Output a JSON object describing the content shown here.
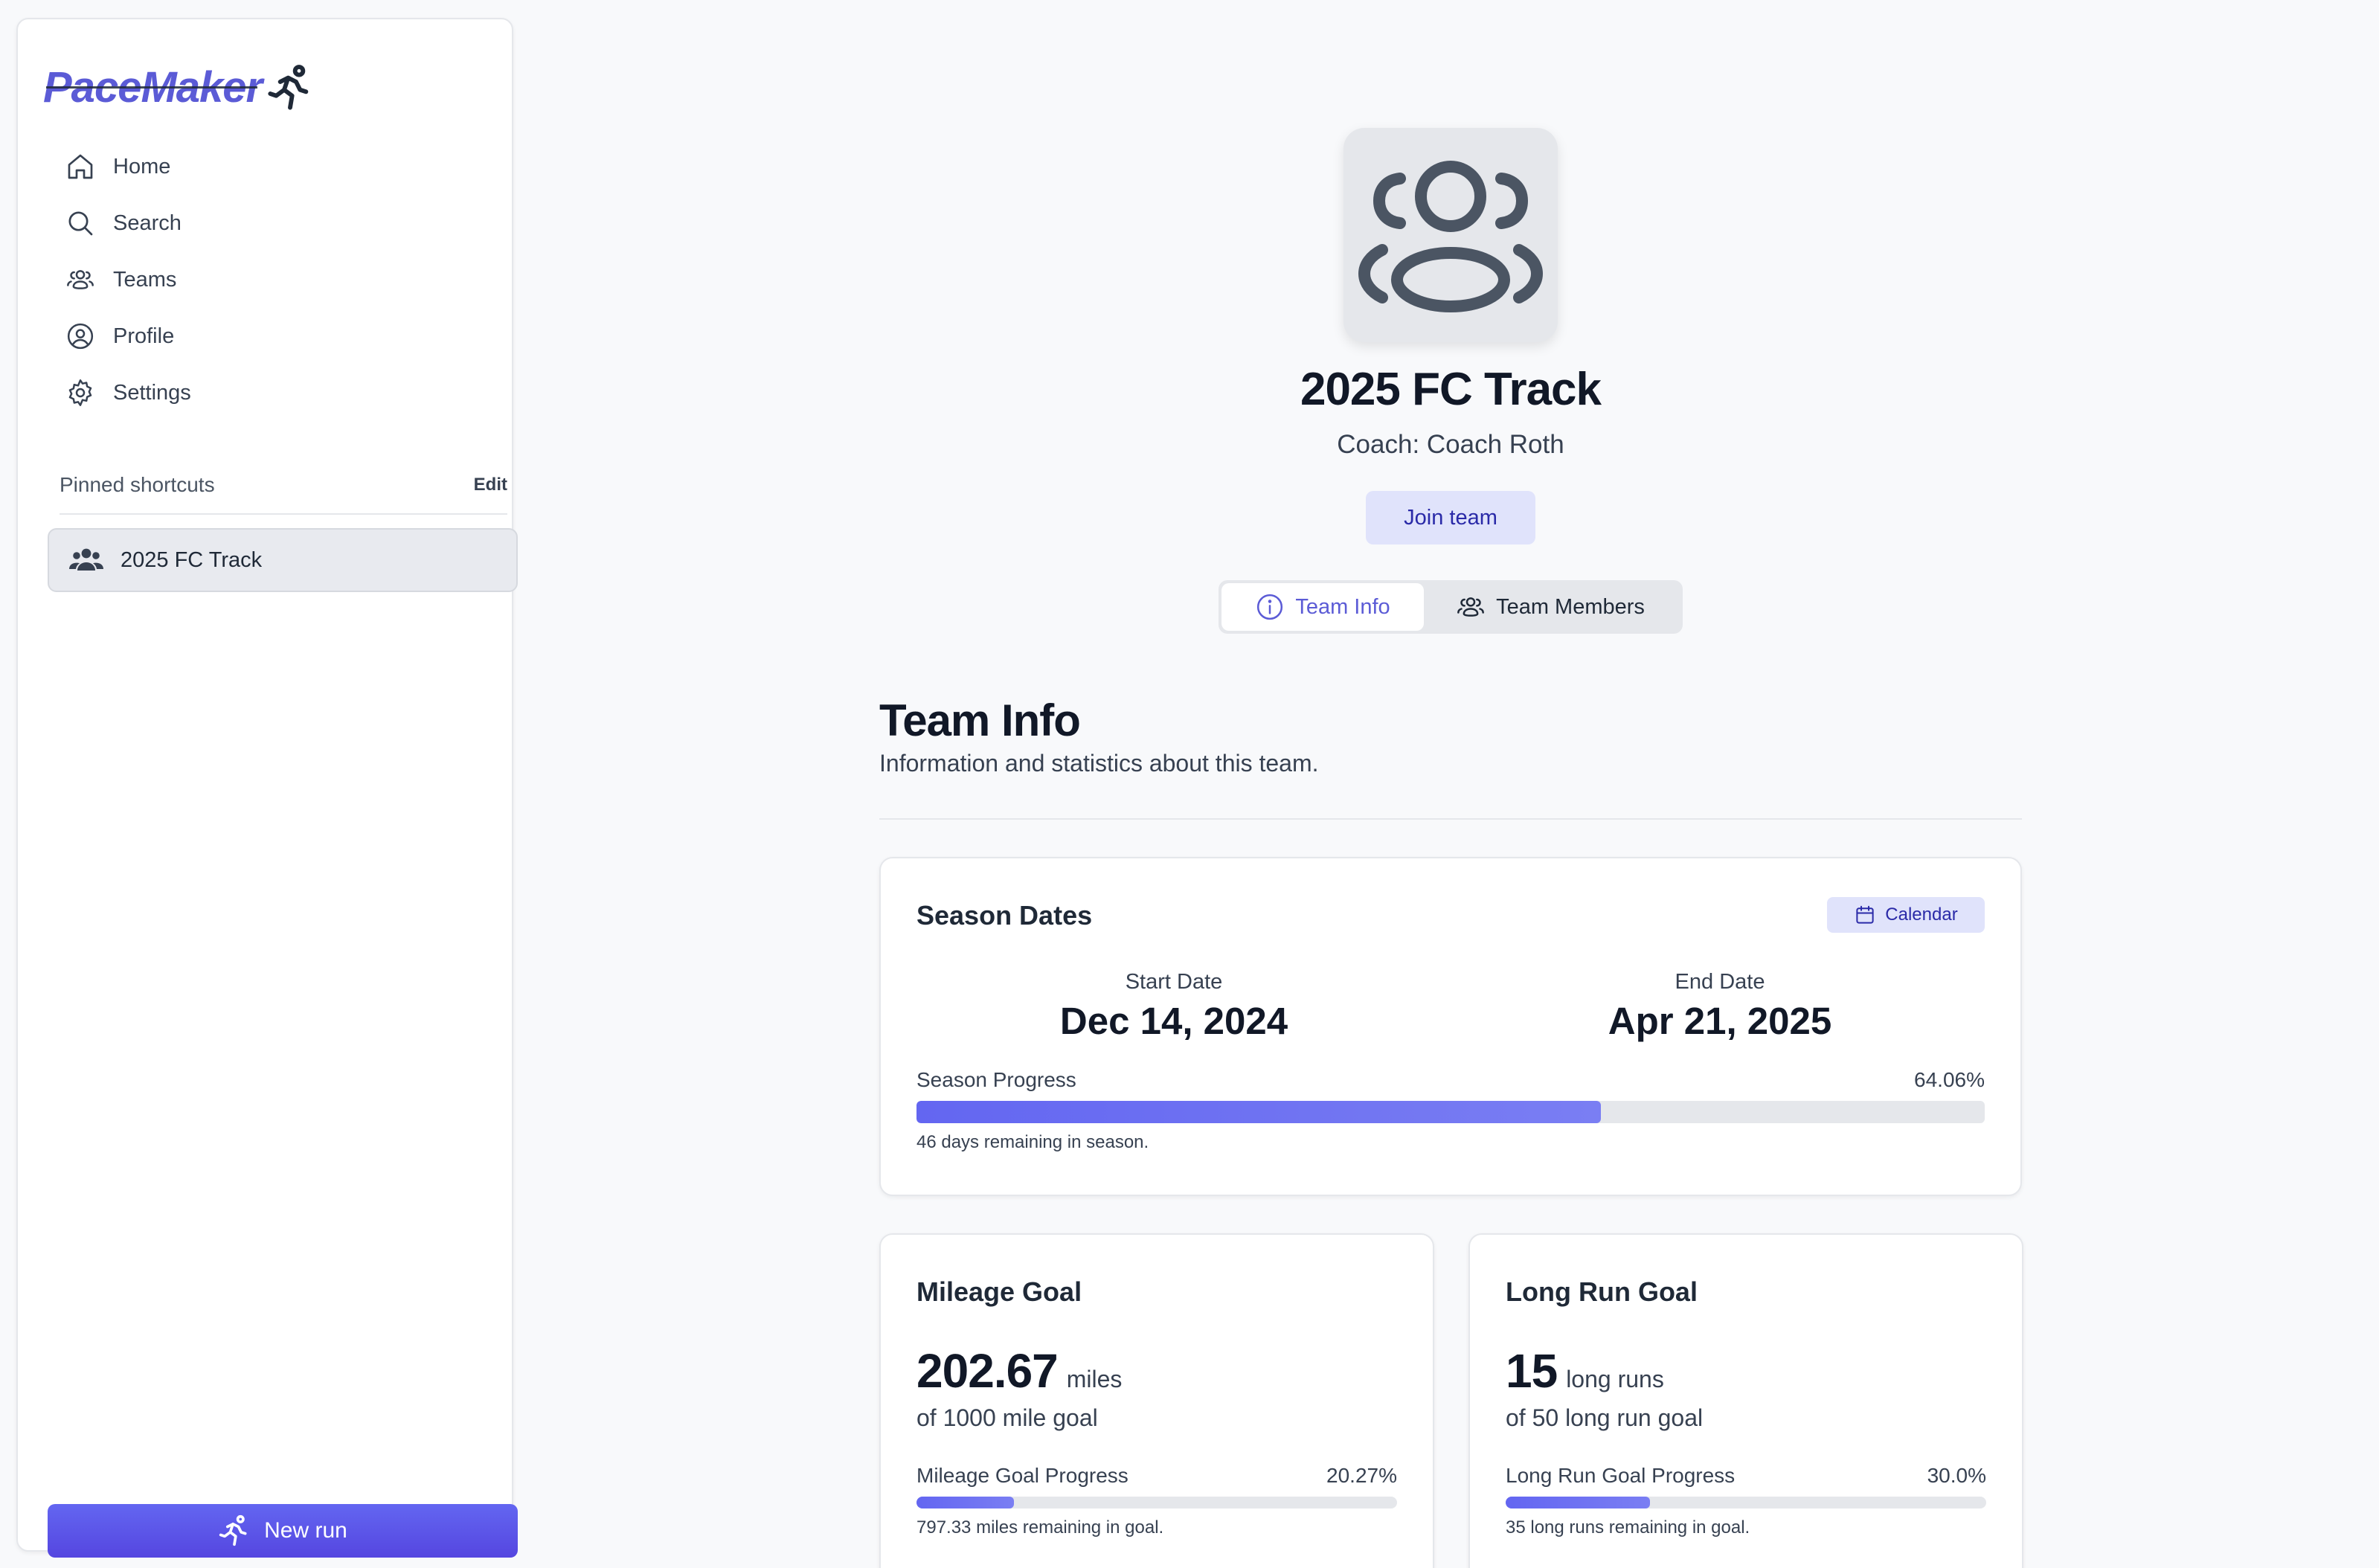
{
  "app": {
    "name": "PaceMaker"
  },
  "sidebar": {
    "nav": [
      {
        "label": "Home",
        "icon": "home-icon"
      },
      {
        "label": "Search",
        "icon": "search-icon"
      },
      {
        "label": "Teams",
        "icon": "users-icon"
      },
      {
        "label": "Profile",
        "icon": "user-circle-icon"
      },
      {
        "label": "Settings",
        "icon": "gear-icon"
      }
    ],
    "pinned": {
      "title": "Pinned shortcuts",
      "edit_label": "Edit",
      "items": [
        {
          "label": "2025 FC Track",
          "icon": "team-icon"
        }
      ]
    },
    "new_run_label": "New run"
  },
  "team": {
    "name": "2025 FC Track",
    "coach": "Coach: Coach Roth",
    "join_label": "Join team"
  },
  "tabs": [
    {
      "label": "Team Info",
      "icon": "info-icon",
      "active": true
    },
    {
      "label": "Team Members",
      "icon": "users-icon",
      "active": false
    }
  ],
  "team_info": {
    "title": "Team Info",
    "subtitle": "Information and statistics about this team.",
    "season": {
      "title": "Season Dates",
      "calendar_label": "Calendar",
      "start_label": "Start Date",
      "start_value": "Dec 14, 2024",
      "end_label": "End Date",
      "end_value": "Apr 21, 2025",
      "progress_label": "Season Progress",
      "progress_text": "64.06%",
      "progress_fraction": 0.6406,
      "note": "46 days remaining in season."
    },
    "mileage": {
      "title": "Mileage Goal",
      "value": "202.67",
      "unit": "miles",
      "of_goal": "of 1000 mile goal",
      "progress_label": "Mileage Goal Progress",
      "progress_text": "20.27%",
      "progress_fraction": 0.2027,
      "note": "797.33 miles remaining in goal."
    },
    "long_run": {
      "title": "Long Run Goal",
      "value": "15",
      "unit": "long runs",
      "of_goal": "of 50 long run goal",
      "progress_label": "Long Run Goal Progress",
      "progress_text": "30.0%",
      "progress_fraction": 0.3,
      "note": "35 long runs remaining in goal."
    }
  },
  "colors": {
    "accent": "#5b5bd6",
    "accent_soft": "#e0e3fb",
    "progress": "#6366f1",
    "background": "#f8f9fb"
  }
}
